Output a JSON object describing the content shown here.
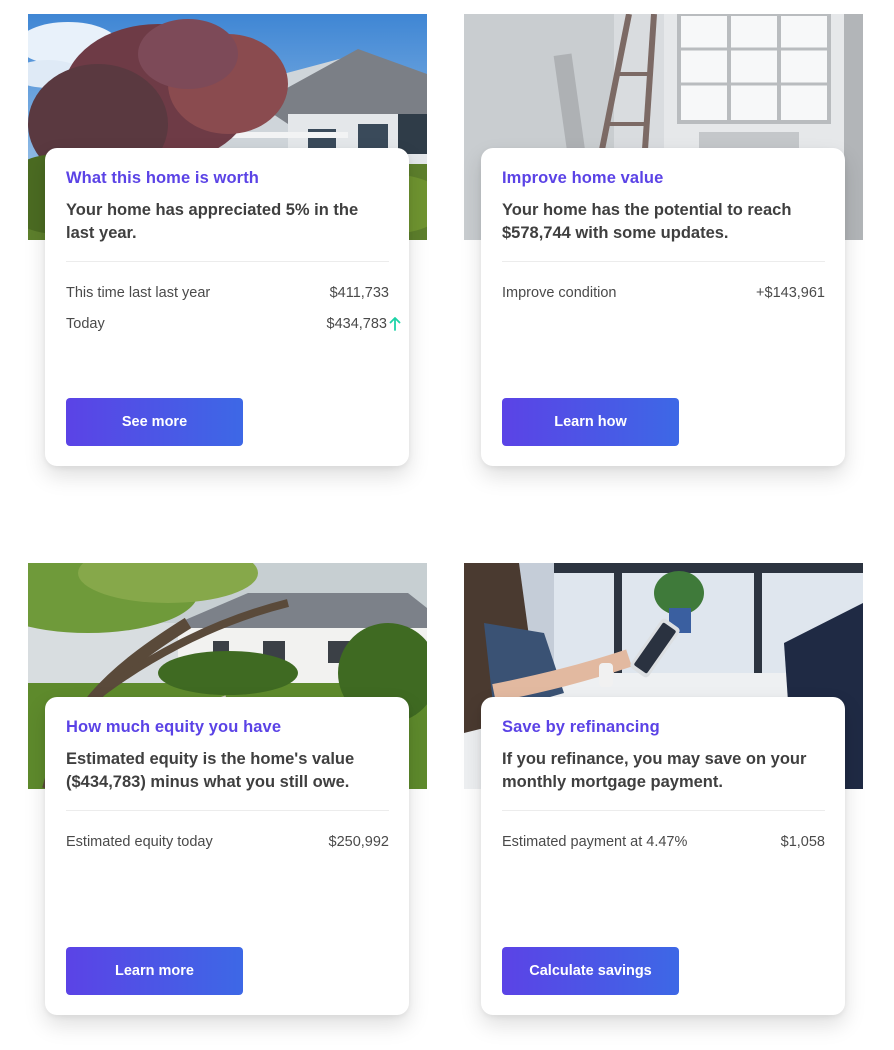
{
  "cards": [
    {
      "title": "What this home is worth",
      "headline": "Your home has appreciated 5% in the last year.",
      "rows": [
        {
          "label": "This time last last year",
          "value": "$411,733"
        },
        {
          "label": "Today",
          "value": "$434,783",
          "icon": "arrow-up-icon"
        }
      ],
      "button": "See more",
      "photo": "house-exterior-trees"
    },
    {
      "title": "Improve home value",
      "headline": "Your home has the potential to reach $578,744 with some updates.",
      "rows": [
        {
          "label": "Improve condition",
          "value": "+$143,961"
        }
      ],
      "button": "Learn how",
      "photo": "room-renovation-ladder"
    },
    {
      "title": "How much equity you have",
      "headline": "Estimated equity is the home's value ($434,783) minus what you still owe.",
      "rows": [
        {
          "label": "Estimated equity today",
          "value": "$250,992"
        }
      ],
      "button": "Learn more",
      "photo": "house-with-large-tree"
    },
    {
      "title": "Save by refinancing",
      "headline": "If you refinance, you may save on your monthly mortgage payment.",
      "rows": [
        {
          "label": "Estimated payment at 4.47%",
          "value": "$1,058"
        }
      ],
      "button": "Calculate savings",
      "photo": "person-with-phone"
    }
  ],
  "colors": {
    "accent": "#5b43e6",
    "button_gradient_end": "#3d68e6",
    "up_arrow": "#1dd3a7"
  }
}
